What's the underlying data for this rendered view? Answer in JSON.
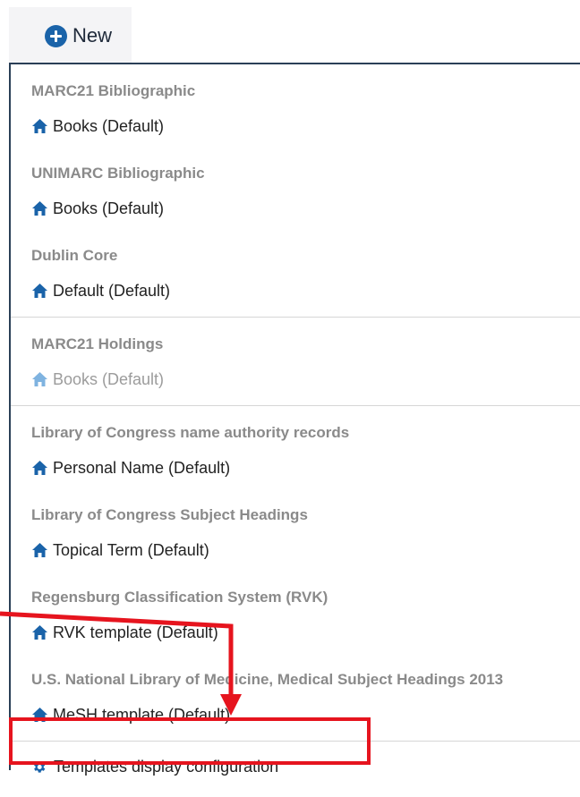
{
  "new_button": {
    "label": "New",
    "icon": "plus-circle-icon"
  },
  "groups": [
    {
      "title": "MARC21 Bibliographic",
      "items": [
        {
          "label": "Books (Default)",
          "disabled": false
        }
      ]
    },
    {
      "title": "UNIMARC Bibliographic",
      "items": [
        {
          "label": "Books (Default)",
          "disabled": false
        }
      ]
    },
    {
      "title": "Dublin Core",
      "items": [
        {
          "label": "Default (Default)",
          "disabled": false
        }
      ]
    },
    {
      "title": "MARC21 Holdings",
      "items": [
        {
          "label": "Books (Default)",
          "disabled": true
        }
      ]
    },
    {
      "title": "Library of Congress name authority records",
      "items": [
        {
          "label": "Personal Name (Default)",
          "disabled": false
        }
      ]
    },
    {
      "title": "Library of Congress Subject Headings",
      "items": [
        {
          "label": "Topical Term (Default)",
          "disabled": false
        }
      ]
    },
    {
      "title": "Regensburg Classification System (RVK)",
      "items": [
        {
          "label": "RVK template (Default)",
          "disabled": false
        }
      ]
    },
    {
      "title": "U.S. National Library of Medicine, Medical Subject Headings 2013",
      "items": [
        {
          "label": "MeSH template (Default)",
          "disabled": false
        }
      ]
    }
  ],
  "config_item": {
    "label": "Templates display configuration",
    "icon": "gear-icon"
  },
  "colors": {
    "accent": "#1a63a9",
    "annotation": "#e6141e",
    "disabled_icon": "#7fb3e0"
  }
}
